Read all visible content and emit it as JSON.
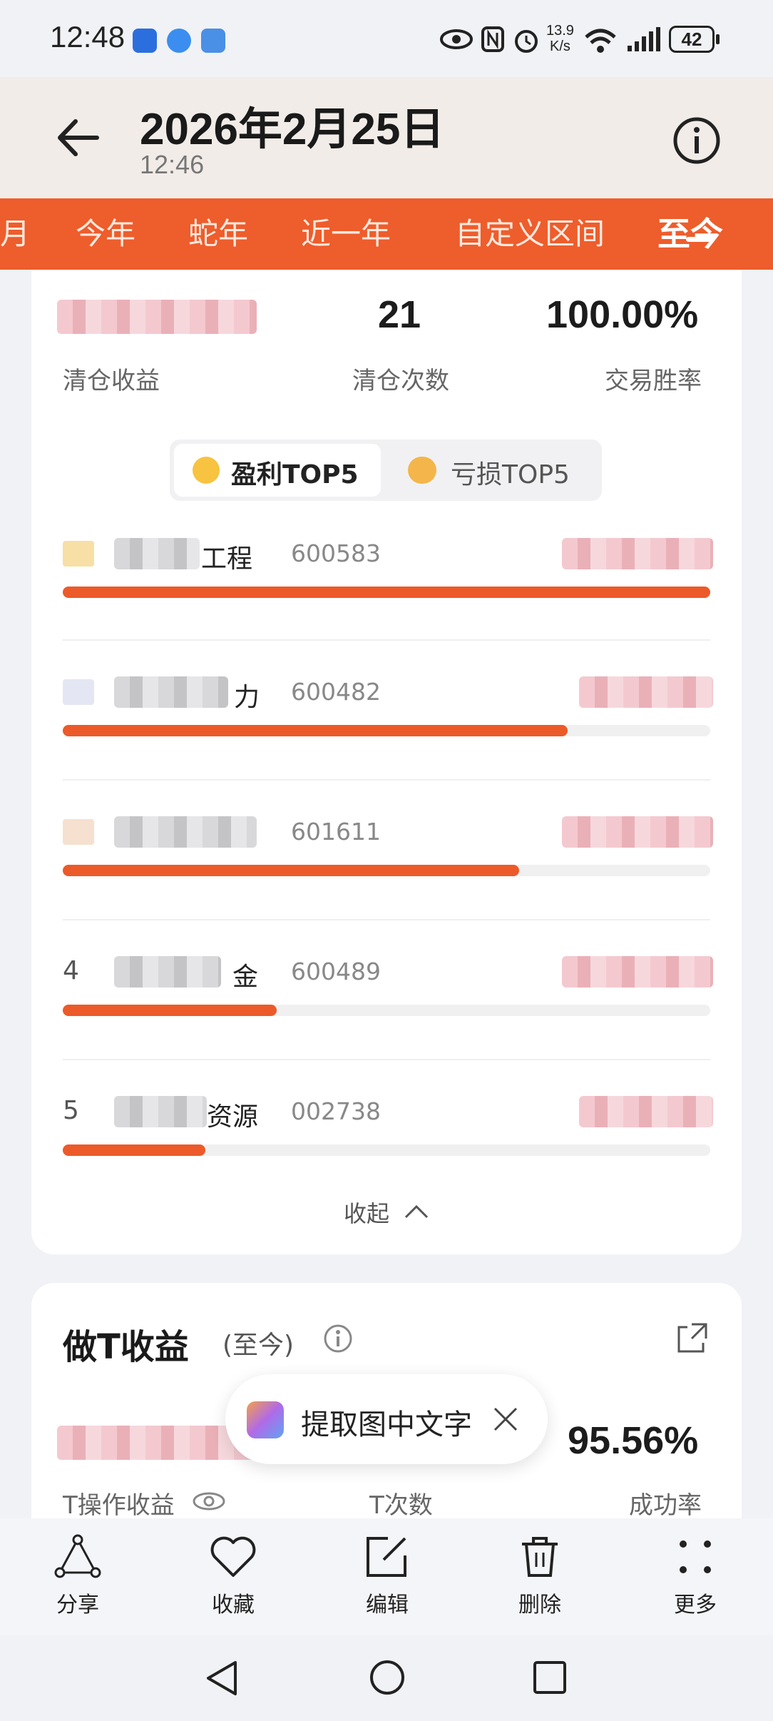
{
  "status_bar": {
    "time": "12:48",
    "speed_top": "13.9",
    "speed_bottom": "K/s",
    "battery": "42"
  },
  "header": {
    "date": "2026年2月25日",
    "time": "12:46"
  },
  "period_tabs": [
    {
      "label": "月"
    },
    {
      "label": "今年"
    },
    {
      "label": "蛇年"
    },
    {
      "label": "近一年"
    },
    {
      "label": "自定义区间"
    },
    {
      "label": "至今",
      "active": true
    }
  ],
  "clearance_summary": {
    "count_value": "21",
    "win_rate_value": "100.00%",
    "profit_label": "清仓收益",
    "count_label": "清仓次数",
    "win_rate_label": "交易胜率"
  },
  "toggle": {
    "profit_tab": "盈利TOP5",
    "loss_tab": "亏损TOP5"
  },
  "top5": [
    {
      "rank": "",
      "name_suffix": "工程",
      "code": "600583",
      "progress": 1.0
    },
    {
      "rank": "",
      "name_suffix": "力",
      "code": "600482",
      "progress": 0.78
    },
    {
      "rank": "",
      "name_suffix": "",
      "code": "601611",
      "progress": 0.705
    },
    {
      "rank": "4",
      "name_suffix": "金",
      "code": "600489",
      "progress": 0.33
    },
    {
      "rank": "5",
      "name_suffix": "资源",
      "code": "002738",
      "progress": 0.22
    }
  ],
  "collapse_label": "收起",
  "t_trade": {
    "title": "做T收益",
    "period": "(至今)",
    "success_rate_value": "95.56%",
    "profit_label": "T操作收益",
    "count_label": "T次数",
    "success_rate_label": "成功率"
  },
  "ocr_popup": {
    "label": "提取图中文字"
  },
  "bottom_toolbar": [
    {
      "label": "分享"
    },
    {
      "label": "收藏"
    },
    {
      "label": "编辑"
    },
    {
      "label": "删除"
    },
    {
      "label": "更多"
    }
  ],
  "colors": {
    "accent": "#ee5d2c",
    "bar": "#ec5a2a"
  }
}
